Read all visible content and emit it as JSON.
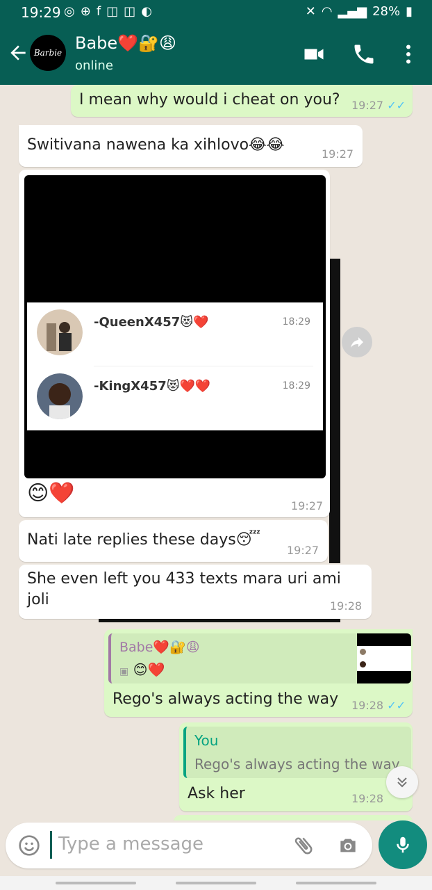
{
  "status": {
    "time": "19:29",
    "battery": "28%"
  },
  "header": {
    "avatar_text": "Barbie",
    "contact_name": "Babe❤️🔐😩",
    "status": "online"
  },
  "messages": [
    {
      "text": "I mean why would i cheat on you?",
      "time": "19:27"
    },
    {
      "text": "Switivana nawena ka xihlovo😂😂",
      "time": "19:27"
    },
    {
      "caption": "😊❤️",
      "time": "19:27",
      "screenshot_rows": [
        {
          "name": "-QueenX457😻❤️",
          "time": "18:29"
        },
        {
          "name": "-KingX457😻❤️❤️",
          "time": "18:29"
        }
      ]
    },
    {
      "text": "Nati late replies these days😴",
      "time": "19:27"
    },
    {
      "text": "She even left you 433 texts mara uri ami joli",
      "time": "19:28"
    },
    {
      "quote_author": "Babe❤️🔐😩",
      "quote_text": "😊❤️",
      "text": "Rego's always acting the way",
      "time": "19:28"
    },
    {
      "quote_author": "You",
      "quote_text": "Rego's always acting the way",
      "text": "Ask her",
      "time": "19:28"
    }
  ],
  "composer": {
    "placeholder": "Type a message"
  },
  "colors": {
    "header": "#075e54",
    "incoming": "#ffffff",
    "outgoing": "#dcf8c6",
    "ticks": "#4fc3f7",
    "fab": "#128c7e"
  }
}
